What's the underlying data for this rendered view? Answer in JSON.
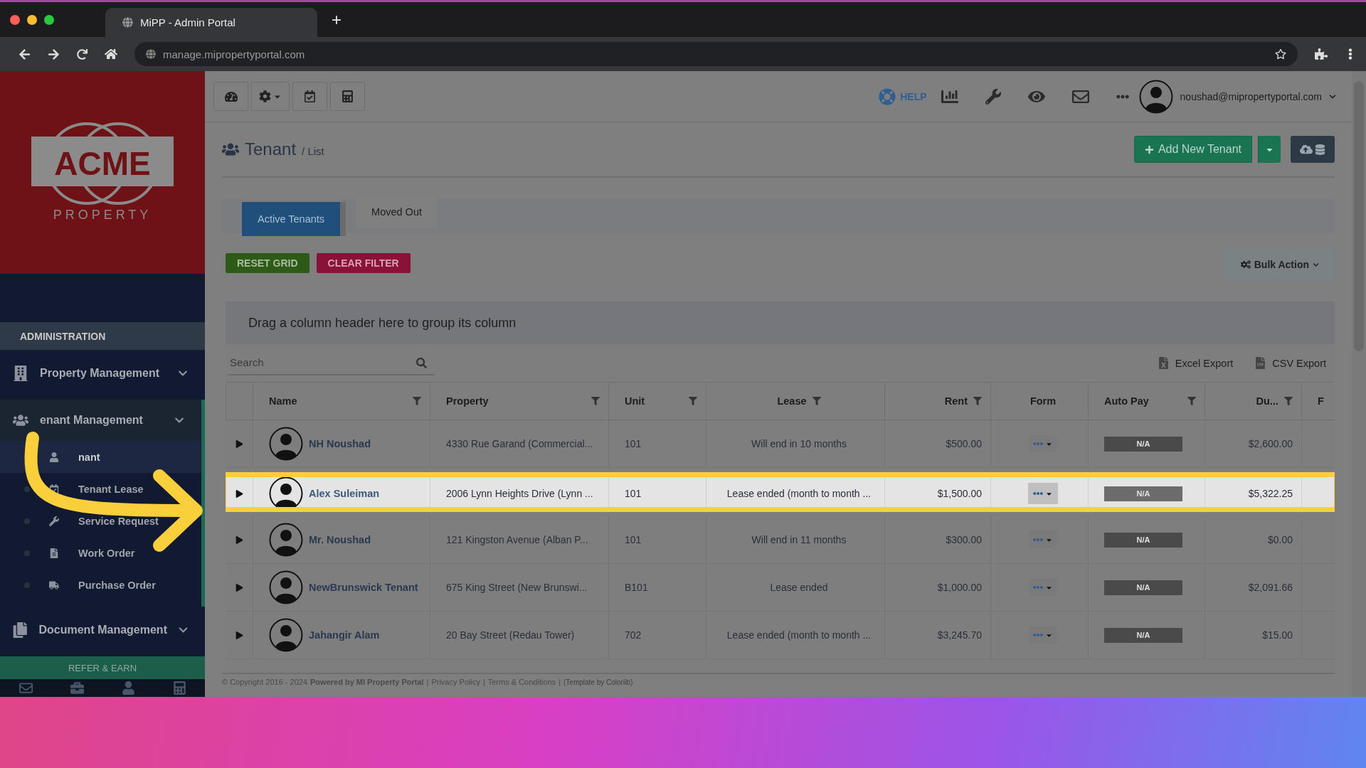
{
  "browser": {
    "tab_title": "MiPP - Admin Portal",
    "new_tab": "+",
    "url": "manage.mipropertyportal.com"
  },
  "sidebar": {
    "logo": {
      "word": "ACME",
      "sub": "PROPERTY"
    },
    "section": "ADMINISTRATION",
    "items": [
      {
        "label": "Property Management",
        "active": false
      },
      {
        "label": "enant Management",
        "active": true,
        "children": [
          {
            "label": "nant",
            "selected": true
          },
          {
            "label": "Tenant Lease",
            "selected": false
          },
          {
            "label": "Service Request",
            "selected": false
          },
          {
            "label": "Work Order",
            "selected": false
          },
          {
            "label": "Purchase Order",
            "selected": false
          }
        ]
      },
      {
        "label": "Document Management",
        "active": false
      }
    ],
    "refer": "REFER & EARN"
  },
  "topbar": {
    "help": "HELP",
    "user": "noushad@mipropertyportal.com"
  },
  "page": {
    "title": "Tenant",
    "crumb": "/ List",
    "add_button": "Add New Tenant"
  },
  "tabs": [
    {
      "label": "Active Tenants",
      "selected": true
    },
    {
      "label": "Moved Out",
      "selected": false
    }
  ],
  "actions": {
    "reset": "RESET GRID",
    "clear": "CLEAR FILTER",
    "bulk": "Bulk Action"
  },
  "grid": {
    "group_hint": "Drag a column header here to group its column",
    "search": {
      "placeholder": "Search"
    },
    "exports": [
      "Excel Export",
      "CSV Export"
    ],
    "columns": [
      {
        "label": "Name",
        "filter": true
      },
      {
        "label": "Property",
        "filter": true
      },
      {
        "label": "Unit",
        "filter": true
      },
      {
        "label": "Lease",
        "filter": true
      },
      {
        "label": "Rent",
        "filter": true
      },
      {
        "label": "Form",
        "filter": false
      },
      {
        "label": "Auto Pay",
        "filter": true
      },
      {
        "label": "Du...",
        "filter": true
      },
      {
        "label": "F"
      }
    ],
    "rows": [
      {
        "name": "NH Noushad",
        "property": "4330 Rue Garand (Commercial...",
        "unit": "101",
        "lease": "Will end in 10 months",
        "rent": "$500.00",
        "auto_pay": "N/A",
        "due": "$2,600.00",
        "highlighted": false
      },
      {
        "name": "Alex Suleiman",
        "property": "2006 Lynn Heights Drive (Lynn ...",
        "unit": "101",
        "lease": "Lease ended (month to month ...",
        "rent": "$1,500.00",
        "auto_pay": "N/A",
        "due": "$5,322.25",
        "highlighted": true
      },
      {
        "name": "Mr. Noushad",
        "property": "121 Kingston Avenue (Alban P...",
        "unit": "101",
        "lease": "Will end in 11 months",
        "rent": "$300.00",
        "auto_pay": "N/A",
        "due": "$0.00",
        "highlighted": false
      },
      {
        "name": "NewBrunswick Tenant",
        "property": "675 King Street (New Brunswi...",
        "unit": "B101",
        "lease": "Lease ended",
        "rent": "$1,000.00",
        "auto_pay": "N/A",
        "due": "$2,091.66",
        "highlighted": false
      },
      {
        "name": "Jahangir Alam",
        "property": "20 Bay Street (Redau Tower)",
        "unit": "702",
        "lease": "Lease ended (month to month ...",
        "rent": "$3,245.70",
        "auto_pay": "N/A",
        "due": "$15.00",
        "highlighted": false
      }
    ]
  },
  "footer": {
    "copyright": "© Copyright 2016 - 2024",
    "powered": "Powered by MI Property Portal",
    "separator": "|",
    "links": [
      "Privacy Policy",
      "Terms & Conditions"
    ],
    "template": "(Template by Colorlib)"
  }
}
